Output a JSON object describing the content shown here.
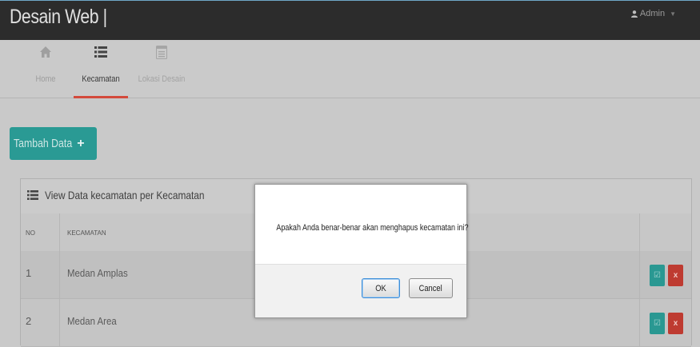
{
  "header": {
    "brand": "Desain Web |",
    "user": "Admin"
  },
  "nav": {
    "home": "Home",
    "kecamatan": "Kecamatan",
    "lokasi": "Lokasi Desain"
  },
  "actions": {
    "add_label": "Tambah Data",
    "add_icon": "+"
  },
  "panel": {
    "title": "View Data kecamatan per Kecamatan",
    "col_no": "NO",
    "col_kec": "KECAMATAN"
  },
  "rows": [
    {
      "no": "1",
      "kecamatan": "Medan Amplas"
    },
    {
      "no": "2",
      "kecamatan": "Medan Area"
    }
  ],
  "row_actions": {
    "edit_icon": "☑",
    "delete_icon": "x"
  },
  "dialog": {
    "message": "Apakah Anda benar-benar akan menghapus kecamatan ini?",
    "ok": "OK",
    "cancel": "Cancel"
  },
  "colors": {
    "accent_teal": "#2a9a94",
    "danger_red": "#be3b31",
    "active_tab": "#d34a3c",
    "navbar": "#2c2c2c"
  }
}
